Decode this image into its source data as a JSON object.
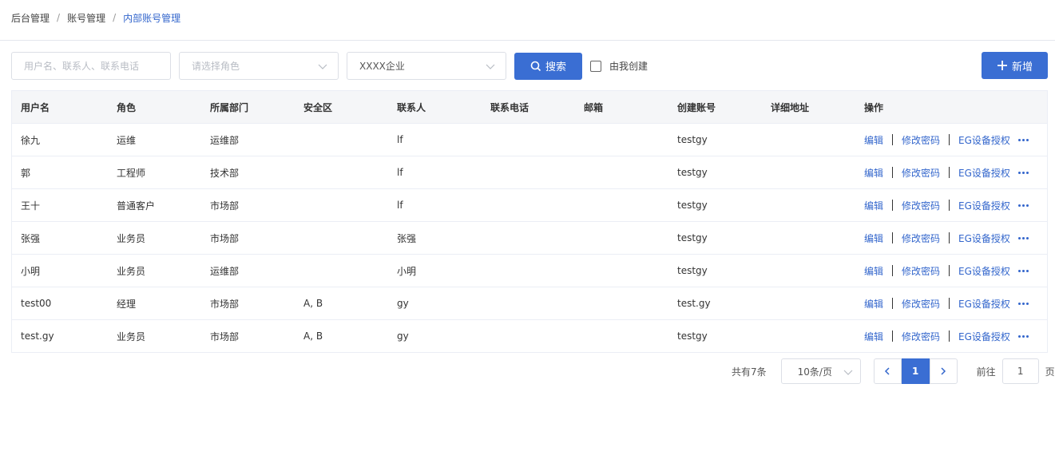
{
  "breadcrumb": [
    "后台管理",
    "账号管理",
    "内部账号管理"
  ],
  "breadcrumb_sep": "/",
  "filters": {
    "name_placeholder": "用户名、联系人、联系电话",
    "role_placeholder": "请选择角色",
    "enterprise_value": "XXXX企业",
    "search_label": "搜索",
    "mine_label": "由我创建",
    "mine_checked": false
  },
  "add_label": "新增",
  "colors": {
    "accent": "#3a6ed3",
    "link": "#3366cc",
    "header_bg": "#f5f6f8",
    "border": "#ebeef5"
  },
  "icons": {
    "search": "search-icon",
    "add": "plus-icon",
    "select": "chevron-down-icon",
    "more": "more-dots-icon",
    "prev": "chevron-left-icon",
    "next": "chevron-right-icon"
  },
  "table": {
    "columns": [
      "用户名",
      "角色",
      "所属部门",
      "安全区",
      "联系人",
      "联系电话",
      "邮箱",
      "创建账号",
      "详细地址",
      "操作"
    ],
    "rows": [
      [
        "徐九",
        "运维",
        "运维部",
        "",
        "lf",
        "",
        "",
        "testgy",
        ""
      ],
      [
        "郭",
        "工程师",
        "技术部",
        "",
        "lf",
        "",
        "",
        "testgy",
        ""
      ],
      [
        "王十",
        "普通客户",
        "市场部",
        "",
        "lf",
        "",
        "",
        "testgy",
        ""
      ],
      [
        "张强",
        "业务员",
        "市场部",
        "",
        "张强",
        "",
        "",
        "testgy",
        ""
      ],
      [
        "小明",
        "业务员",
        "运维部",
        "",
        "小明",
        "",
        "",
        "testgy",
        ""
      ],
      [
        "test00",
        "经理",
        "市场部",
        "A, B",
        "gy",
        "",
        "",
        "test.gy",
        ""
      ],
      [
        "test.gy",
        "业务员",
        "市场部",
        "A, B",
        "gy",
        "",
        "",
        "testgy",
        ""
      ]
    ],
    "actions": [
      "编辑",
      "修改密码",
      "EG设备授权"
    ]
  },
  "pagination": {
    "total_text": "共有7条",
    "page_size": "10条/页",
    "current_page": "1",
    "goto_label": "前往",
    "goto_value": "1",
    "page_unit": "页"
  }
}
